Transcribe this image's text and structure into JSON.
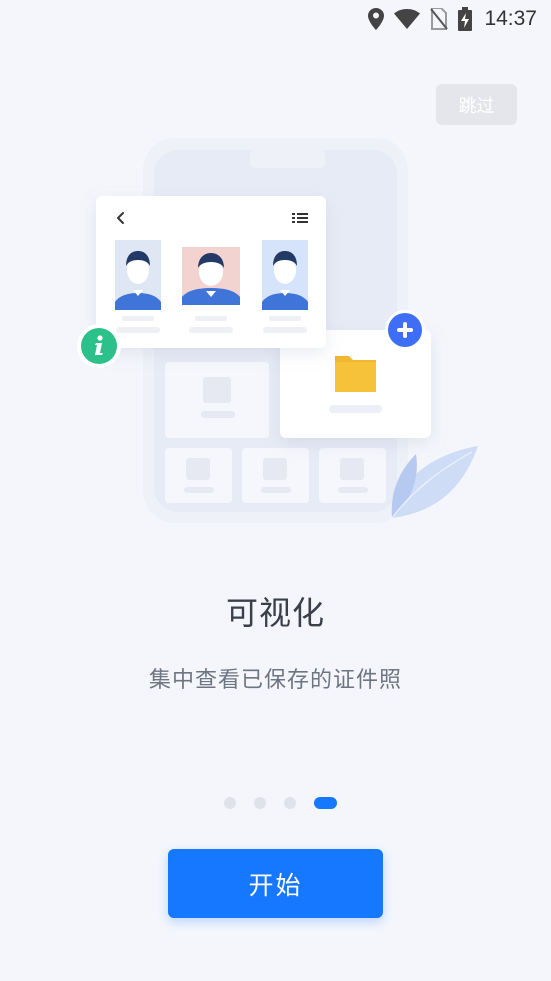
{
  "status_bar": {
    "time": "14:37",
    "icons": [
      "location-icon",
      "wifi-icon",
      "no-sim-icon",
      "battery-charging-icon"
    ]
  },
  "skip": {
    "label": "跳过"
  },
  "illustration": {
    "icons": [
      "back-arrow-icon",
      "list-icon",
      "info-icon",
      "plus-icon",
      "folder-icon",
      "leaf-icon"
    ],
    "photo_backgrounds": [
      "#dfe6f4",
      "#f2d3cf",
      "#d6e4fb"
    ]
  },
  "onboarding": {
    "title": "可视化",
    "subtitle": "集中查看已保存的证件照"
  },
  "pager": {
    "total": 4,
    "active_index": 3
  },
  "start": {
    "label": "开始"
  },
  "colors": {
    "accent": "#1677ff",
    "green": "#2cc08a",
    "folder": "#f5c23a"
  }
}
